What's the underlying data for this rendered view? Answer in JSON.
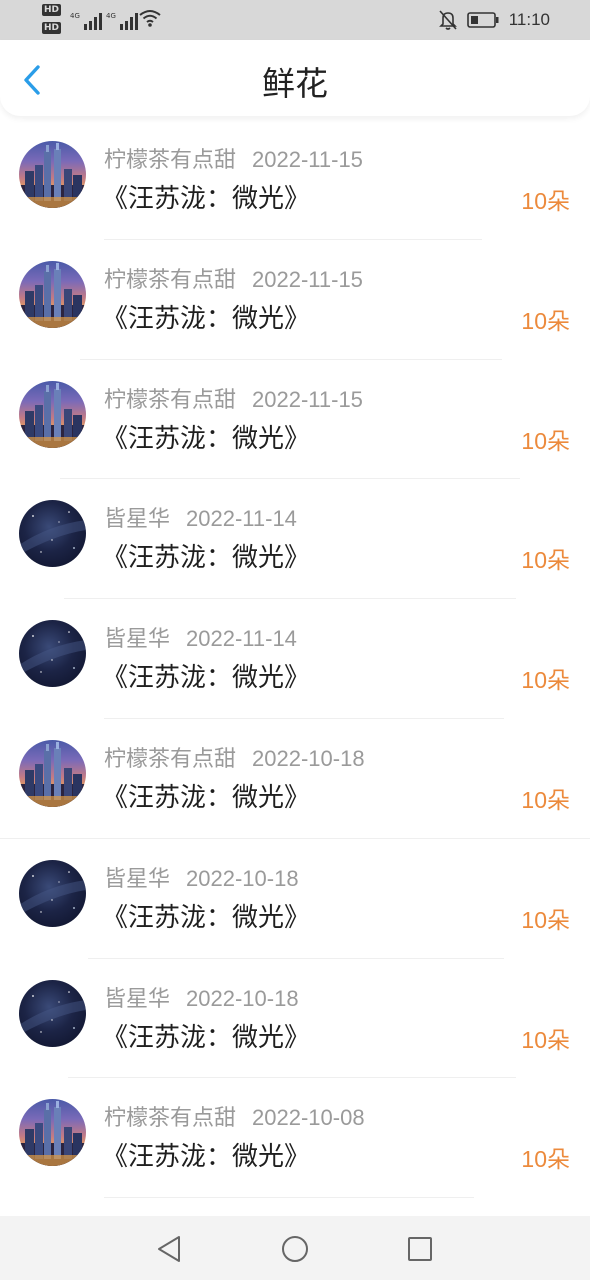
{
  "status_bar": {
    "hd_top": "HD",
    "hd_bottom": "HD",
    "network_1": "4G",
    "network_2": "4G",
    "time": "11:10",
    "icons": [
      "signal-icon",
      "wifi-icon",
      "bell-off-icon",
      "battery-icon"
    ]
  },
  "header": {
    "title": "鲜花",
    "back_icon": "chevron-left-icon",
    "accent_color": "#2a9de8"
  },
  "items": [
    {
      "name": "柠檬茶有点甜",
      "date": "2022-11-15",
      "title": "《汪苏泷：微光》",
      "flowers": "10朵",
      "avatar": "city"
    },
    {
      "name": "柠檬茶有点甜",
      "date": "2022-11-15",
      "title": "《汪苏泷：微光》",
      "flowers": "10朵",
      "avatar": "city"
    },
    {
      "name": "柠檬茶有点甜",
      "date": "2022-11-15",
      "title": "《汪苏泷：微光》",
      "flowers": "10朵",
      "avatar": "city"
    },
    {
      "name": "皆星华",
      "date": "2022-11-14",
      "title": "《汪苏泷：微光》",
      "flowers": "10朵",
      "avatar": "galaxy"
    },
    {
      "name": "皆星华",
      "date": "2022-11-14",
      "title": "《汪苏泷：微光》",
      "flowers": "10朵",
      "avatar": "galaxy"
    },
    {
      "name": "柠檬茶有点甜",
      "date": "2022-10-18",
      "title": "《汪苏泷：微光》",
      "flowers": "10朵",
      "avatar": "city"
    },
    {
      "name": "皆星华",
      "date": "2022-10-18",
      "title": "《汪苏泷：微光》",
      "flowers": "10朵",
      "avatar": "galaxy"
    },
    {
      "name": "皆星华",
      "date": "2022-10-18",
      "title": "《汪苏泷：微光》",
      "flowers": "10朵",
      "avatar": "galaxy"
    },
    {
      "name": "柠檬茶有点甜",
      "date": "2022-10-08",
      "title": "《汪苏泷：微光》",
      "flowers": "10朵",
      "avatar": "city"
    }
  ],
  "colors": {
    "flowers": "#ec8a3c",
    "meta_text": "#9a9a9a",
    "title_text": "#1f1f1f"
  },
  "nav_bar": {
    "icons": [
      "back-triangle-icon",
      "home-circle-icon",
      "recents-square-icon"
    ]
  }
}
